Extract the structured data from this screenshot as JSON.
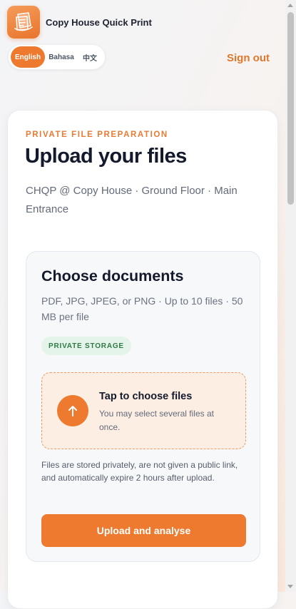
{
  "header": {
    "brand_name": "Copy House Quick Print",
    "logo_icon": "printer-paper-icon",
    "languages": [
      "English",
      "Bahasa",
      "中文"
    ],
    "active_language": "English",
    "sign_out": "Sign out"
  },
  "main": {
    "eyebrow": "PRIVATE FILE PREPARATION",
    "title": "Upload your files",
    "location": "CHQP @ Copy House · Ground Floor · Main Entrance",
    "upload_panel": {
      "heading": "Choose documents",
      "formats": "PDF, JPG, JPEG, or PNG · Up to 10 files · 50 MB per file",
      "badge": "PRIVATE STORAGE",
      "dropzone": {
        "icon": "arrow-up-icon",
        "title": "Tap to choose files",
        "subtitle": "You may select several files at once."
      },
      "privacy_note": "Files are stored privately, are not given a public link, and automatically expire 2 hours after upload.",
      "submit_label": "Upload and analyse"
    }
  },
  "colors": {
    "accent": "#ee7a30",
    "badge_bg": "#e5f4ea",
    "badge_text": "#2f7a45",
    "dropzone_bg": "#fdeee4"
  }
}
